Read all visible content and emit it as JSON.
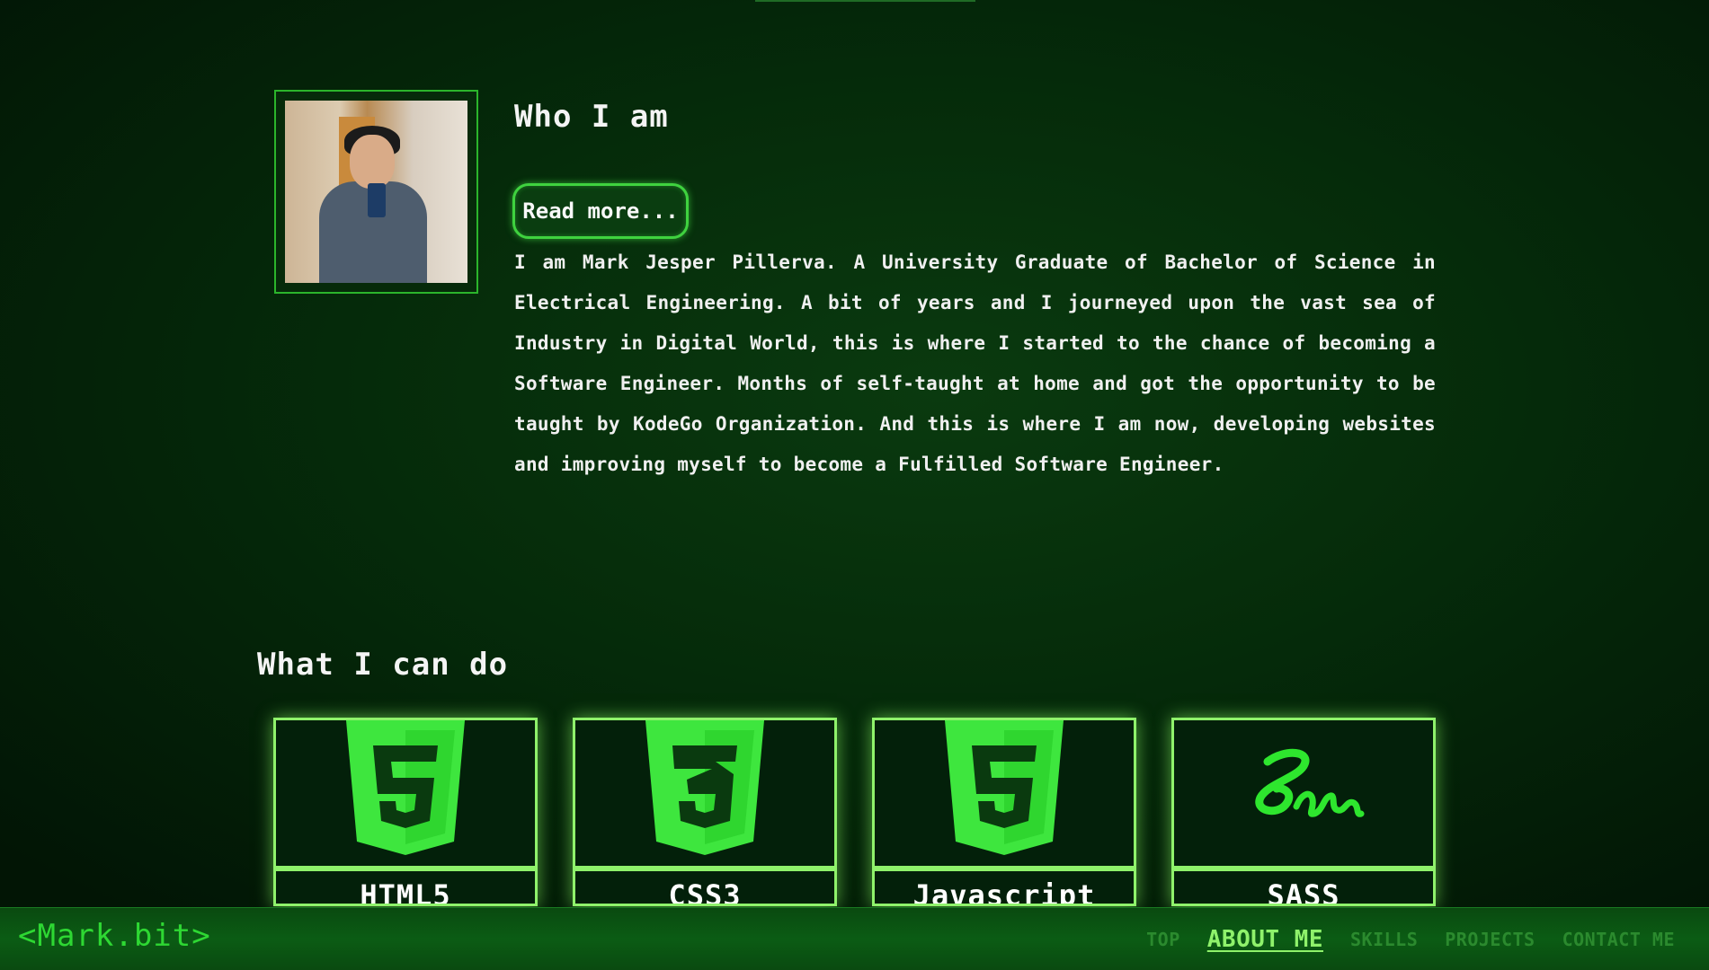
{
  "about": {
    "title": "Who I am",
    "read_more_label": "Read more...",
    "text": "I am Mark Jesper Pillerva. A University Graduate of Bachelor of Science in Electrical Engineering. A bit of years and I journeyed upon the vast sea of Industry in Digital World, this is where I started to the chance of becoming a Software Engineer. Months of self-taught at home and got the opportunity to be taught by KodeGo Organization. And this is where I am now, developing websites and improving myself to become a Fulfilled Software Engineer."
  },
  "skills": {
    "title": "What I can do",
    "items": [
      {
        "name": "HTML5",
        "icon": "html5-icon"
      },
      {
        "name": "CSS3",
        "icon": "css3-icon"
      },
      {
        "name": "Javascript",
        "icon": "javascript-icon"
      },
      {
        "name": "SASS",
        "icon": "sass-icon"
      }
    ]
  },
  "nav": {
    "logo": "<Mark.bit>",
    "links": [
      "TOP",
      "ABOUT ME",
      "SKILLS",
      "PROJECTS",
      "CONTACT ME"
    ],
    "active": "ABOUT ME"
  },
  "colors": {
    "accent": "#8ff26b",
    "logo_green": "#2ed833",
    "background": "#052b0a"
  }
}
